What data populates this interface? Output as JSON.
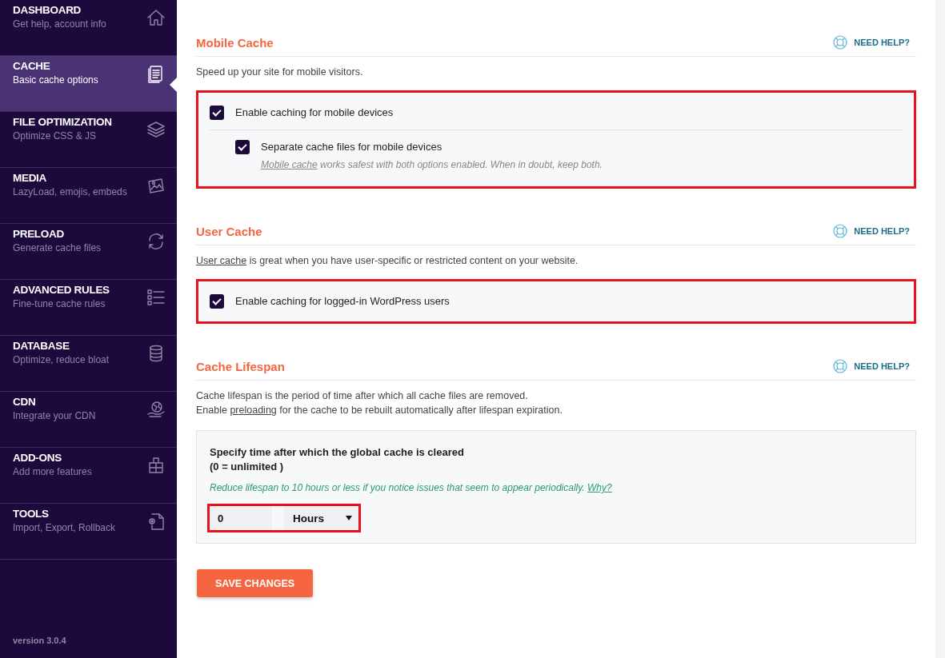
{
  "sidebar": {
    "items": [
      {
        "title": "DASHBOARD",
        "subtitle": "Get help, account info",
        "selected": false
      },
      {
        "title": "CACHE",
        "subtitle": "Basic cache options",
        "selected": true
      },
      {
        "title": "FILE OPTIMIZATION",
        "subtitle": "Optimize CSS & JS",
        "selected": false
      },
      {
        "title": "MEDIA",
        "subtitle": "LazyLoad, emojis, embeds",
        "selected": false
      },
      {
        "title": "PRELOAD",
        "subtitle": "Generate cache files",
        "selected": false
      },
      {
        "title": "ADVANCED RULES",
        "subtitle": "Fine-tune cache rules",
        "selected": false
      },
      {
        "title": "DATABASE",
        "subtitle": "Optimize, reduce bloat",
        "selected": false
      },
      {
        "title": "CDN",
        "subtitle": "Integrate your CDN",
        "selected": false
      },
      {
        "title": "ADD-ONS",
        "subtitle": "Add more features",
        "selected": false
      },
      {
        "title": "TOOLS",
        "subtitle": "Import, Export, Rollback",
        "selected": false
      }
    ],
    "version": "version 3.0.4"
  },
  "sections": [
    {
      "title": "Mobile Cache",
      "help": "NEED HELP?",
      "description": [
        [
          {
            "text": "Speed up your site for mobile visitors."
          }
        ]
      ],
      "panel": {
        "highlighted": true,
        "options": [
          {
            "label": "Enable caching for mobile devices",
            "checked": true,
            "nested": false
          },
          {
            "label": "Separate cache files for mobile devices",
            "checked": true,
            "nested": true,
            "note": [
              {
                "link": "Mobile cache"
              },
              {
                "text": " works safest with both options enabled. When in doubt, keep both."
              }
            ]
          }
        ]
      }
    },
    {
      "title": "User Cache",
      "help": "NEED HELP?",
      "description": [
        [
          {
            "link": "User cache"
          },
          {
            "text": " is great when you have user-specific or restricted content on your website."
          }
        ]
      ],
      "panel": {
        "highlighted": true,
        "options": [
          {
            "label": "Enable caching for logged-in WordPress users",
            "checked": true,
            "nested": false
          }
        ]
      }
    },
    {
      "title": "Cache Lifespan",
      "help": "NEED HELP?",
      "description": [
        [
          {
            "text": "Cache lifespan is the period of time after which all cache files are removed."
          }
        ],
        [
          {
            "text": "Enable "
          },
          {
            "link": "preloading"
          },
          {
            "text": " for the cache to be rebuilt automatically after lifespan expiration."
          }
        ]
      ],
      "lifespan": {
        "label": "Specify time after which the global cache is cleared",
        "sublabel": "(0 = unlimited )",
        "hint": [
          {
            "text": "Reduce lifespan to 10 hours or less if you notice issues that seem to appear periodically. "
          },
          {
            "link": "Why?"
          }
        ],
        "value": "0",
        "unit": "Hours",
        "highlighted": true
      }
    }
  ],
  "save_button": "SAVE CHANGES"
}
